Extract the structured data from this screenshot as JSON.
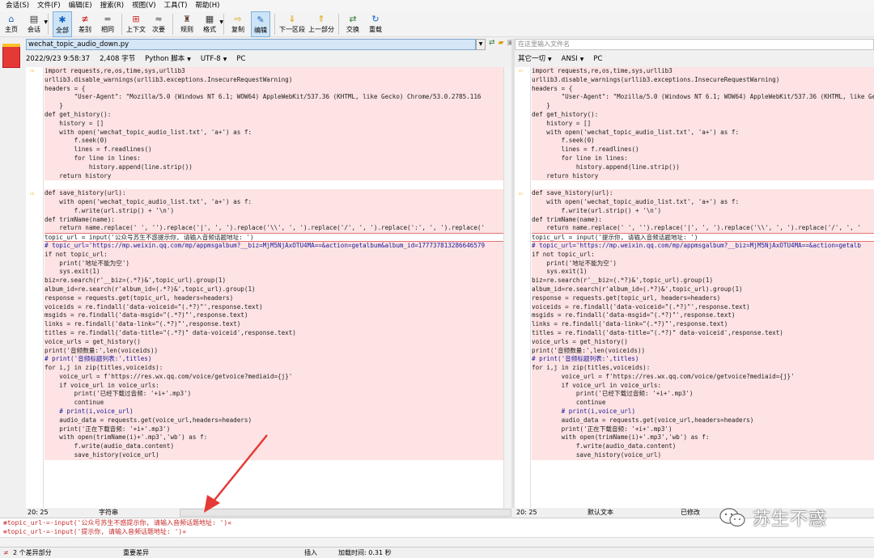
{
  "menu": [
    "会话(S)",
    "文件(F)",
    "编辑(E)",
    "搜索(R)",
    "视图(V)",
    "工具(T)",
    "帮助(H)"
  ],
  "toolbar": [
    {
      "label": "主页",
      "icon": "home-icon",
      "glyph": "⌂"
    },
    {
      "label": "会话",
      "icon": "session-icon",
      "glyph": "▤",
      "dropdown": true
    },
    {
      "label": "全部",
      "icon": "all-icon",
      "glyph": "✱",
      "active": true
    },
    {
      "label": "差别",
      "icon": "diff-icon",
      "glyph": "≢"
    },
    {
      "label": "相同",
      "icon": "same-icon",
      "glyph": "="
    },
    {
      "label": "上下文",
      "icon": "context-icon",
      "glyph": "⊞"
    },
    {
      "label": "次要",
      "icon": "minor-icon",
      "glyph": "≈"
    },
    {
      "label": "规则",
      "icon": "rules-icon",
      "glyph": "♜"
    },
    {
      "label": "格式",
      "icon": "format-icon",
      "glyph": "▦",
      "dropdown": true
    },
    {
      "label": "复制",
      "icon": "copy-icon",
      "glyph": "⇨"
    },
    {
      "label": "编辑",
      "icon": "edit-icon",
      "glyph": "✎",
      "active": true
    },
    {
      "label": "下一区段",
      "icon": "next-section-icon",
      "glyph": "⇓"
    },
    {
      "label": "上一部分",
      "icon": "prev-section-icon",
      "glyph": "⇑"
    },
    {
      "label": "交换",
      "icon": "swap-icon",
      "glyph": "⇄"
    },
    {
      "label": "重载",
      "icon": "reload-icon",
      "glyph": "↻"
    }
  ],
  "left": {
    "filename": "wechat_topic_audio_down.py",
    "info": [
      "2022/9/23 9:58:37",
      "2,408 字节",
      "Python 脚本",
      "UTF-8",
      "PC"
    ],
    "status": [
      "20: 25",
      "字符串"
    ]
  },
  "right": {
    "filename_placeholder": "在这里输入文件名",
    "info": [
      "其它一切",
      "ANSI",
      "PC"
    ],
    "status": [
      "20: 25",
      "默认文本",
      "已修改"
    ]
  },
  "code_left": [
    "import requests,re,os,time,sys,urllib3",
    "urllib3.disable_warnings(urllib3.exceptions.InsecureRequestWarning)",
    "headers = {",
    "        \"User-Agent\": \"Mozilla/5.0 (Windows NT 6.1; WOW64) AppleWebKit/537.36 (KHTML, like Gecko) Chrome/53.0.2785.116",
    "    }",
    "def get_history():",
    "    history = []",
    "    with open('wechat_topic_audio_list.txt', 'a+') as f:",
    "        f.seek(0)",
    "        lines = f.readlines()",
    "        for line in lines:",
    "            history.append(line.strip())",
    "    return history",
    "",
    "def save_history(url):",
    "    with open('wechat_topic_audio_list.txt', 'a+') as f:",
    "        f.write(url.strip() + '\\n')",
    "def trimName(name):",
    "    return name.replace(' ', '').replace('|', ', ').replace('\\\\', ', ').replace('/', ', ').replace(':', ', ').replace('",
    "topic_url = input('公众号苏生不惑提示你, 请输入音频话题地址: ')",
    "# topic_url='https://mp.weixin.qq.com/mp/appmsgalbum?__biz=MjM5NjAxOTU4MA==&action=getalbum&album_id=177737813286646579",
    "if not topic_url:",
    "    print('地址不能为空')",
    "    sys.exit(1)",
    "biz=re.search(r'__biz=(.*?)&',topic_url).group(1)",
    "album_id=re.search(r'album_id=(.*?)&',topic_url).group(1)",
    "response = requests.get(topic_url, headers=headers)",
    "voiceids = re.findall('data-voiceid=\"(.*?)\"',response.text)",
    "msgids = re.findall('data-msgid=\"(.*?)\"',response.text)",
    "links = re.findall('data-link=\"(.*?)\"',response.text)",
    "titles = re.findall('data-title=\"(.*?)\" data-voiceid',response.text)",
    "voice_urls = get_history()",
    "print('音频数量:',len(voiceids))",
    "# print('音频标题列表:',titles)",
    "for i,j in zip(titles,voiceids):",
    "    voice_url = f'https://res.wx.qq.com/voice/getvoice?mediaid={j}'",
    "    if voice_url in voice_urls:",
    "        print('已经下载过音频: '+i+'.mp3')",
    "        continue",
    "    # print(i,voice_url)",
    "    audio_data = requests.get(voice_url,headers=headers)",
    "    print('正在下载音频: '+i+'.mp3')",
    "    with open(trimName(i)+'.mp3','wb') as f:",
    "        f.write(audio_data.content)",
    "        save_history(voice_url)"
  ],
  "code_right": [
    "import requests,re,os,time,sys,urllib3",
    "urllib3.disable_warnings(urllib3.exceptions.InsecureRequestWarning)",
    "headers = {",
    "        \"User-Agent\": \"Mozilla/5.0 (Windows NT 6.1; WOW64) AppleWebKit/537.36 (KHTML, like Gecko",
    "    }",
    "def get_history():",
    "    history = []",
    "    with open('wechat_topic_audio_list.txt', 'a+') as f:",
    "        f.seek(0)",
    "        lines = f.readlines()",
    "        for line in lines:",
    "            history.append(line.strip())",
    "    return history",
    "",
    "def save_history(url):",
    "    with open('wechat_topic_audio_list.txt', 'a+') as f:",
    "        f.write(url.strip() + '\\n')",
    "def trimName(name):",
    "    return name.replace(' ', '').replace('|', ', ').replace('\\\\', ', ').replace('/', ', ' ",
    "topic_url = input('提示你, 请输入音频话题地址: ')",
    "# topic_url='https://mp.weixin.qq.com/mp/appmsgalbum?__biz=MjM5NjAxOTU4MA==&action=getalb",
    "if not topic_url:",
    "    print('地址不能为空')",
    "    sys.exit(1)",
    "biz=re.search(r'__biz=(.*?)&',topic_url).group(1)",
    "album_id=re.search(r'album_id=(.*?)&',topic_url).group(1)",
    "response = requests.get(topic_url, headers=headers)",
    "voiceids = re.findall('data-voiceid=\"(.*?)\"',response.text)",
    "msgids = re.findall('data-msgid=\"(.*?)\"',response.text)",
    "links = re.findall('data-link=\"(.*?)\"',response.text)",
    "titles = re.findall('data-title=\"(.*?)\" data-voiceid',response.text)",
    "voice_urls = get_history()",
    "print('音频数量:',len(voiceids))",
    "# print('音频标题列表:',titles)",
    "for i,j in zip(titles,voiceids):",
    "        voice_url = f'https://res.wx.qq.com/voice/getvoice?mediaid={j}'",
    "        if voice_url in voice_urls:",
    "            print('已经下载过音频: '+i+'.mp3')",
    "            continue",
    "        # print(i,voice_url)",
    "        audio_data = requests.get(voice_url,headers=headers)",
    "        print('正在下载音频: '+i+'.mp3')",
    "        with open(trimName(i)+'.mp3','wb') as f:",
    "            f.write(audio_data.content)",
    "            save_history(voice_url)"
  ],
  "compare": [
    "≢topic_url·=·input('公众号苏生不惑提示你, 请输入音频话题地址: ')¤",
    "≡topic_url·=·input('提示你, 请输入音频话题地址: ')¤"
  ],
  "statusbar": [
    "2 个差异部分",
    "重要差异",
    "插入",
    "加载时间: 0.31 秒"
  ],
  "watermark": "苏生不惑"
}
